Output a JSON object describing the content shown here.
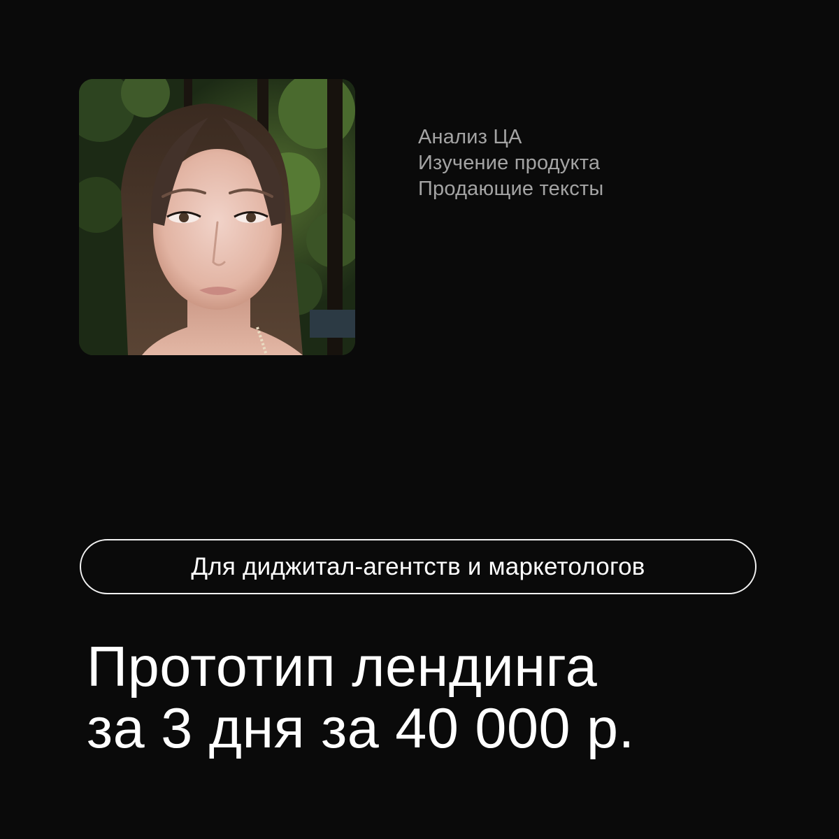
{
  "services": [
    "Анализ ЦА",
    "Изучение продукта",
    "Продающие тексты"
  ],
  "tag": {
    "label": "Для диджитал-агентств и маркетологов"
  },
  "headline": {
    "line1": "Прототип лендинга",
    "line2": "за 3 дня за 40 000 р."
  },
  "colors": {
    "background": "#0a0a0a",
    "text_primary": "#ffffff",
    "text_secondary": "#a4a4a4",
    "tag_border": "#f2f2f2"
  }
}
